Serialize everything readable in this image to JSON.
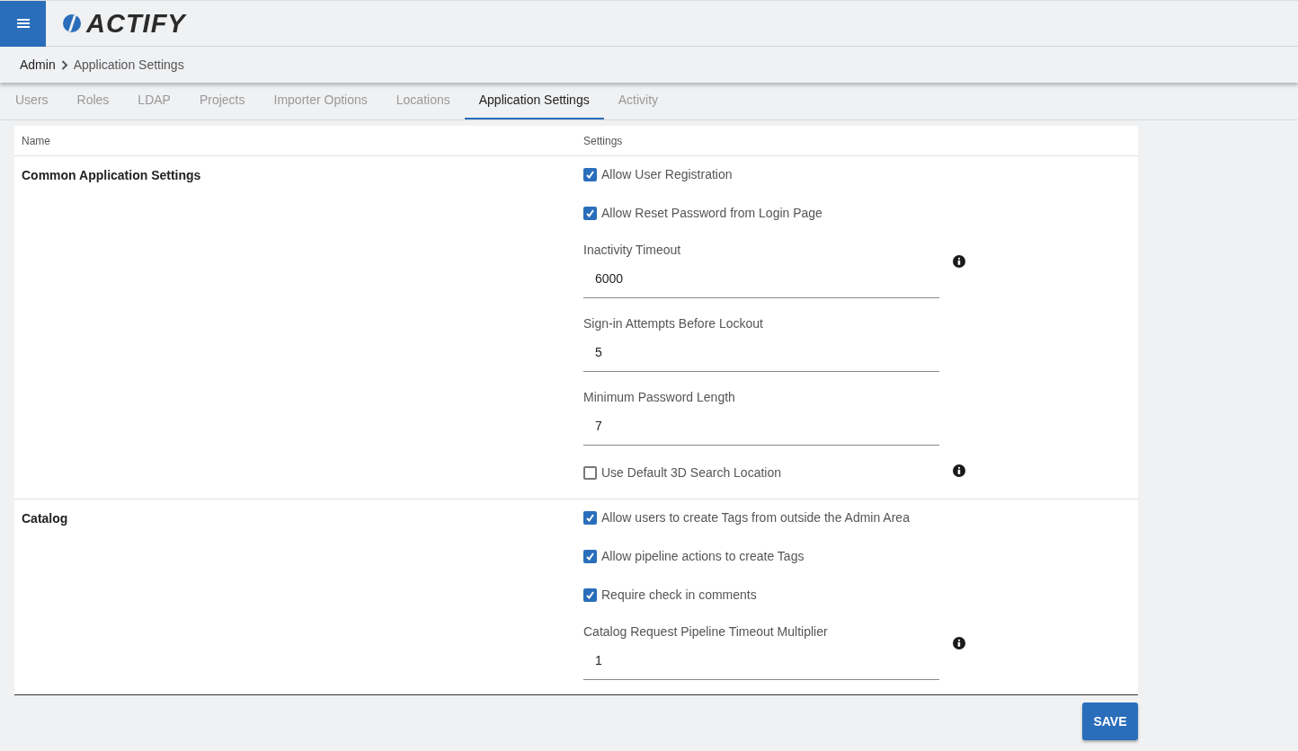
{
  "header": {
    "logo": "ACTIFY"
  },
  "breadcrumb": [
    "Admin",
    "Application Settings"
  ],
  "tabs": [
    {
      "label": "Users",
      "selected": false
    },
    {
      "label": "Roles",
      "selected": false
    },
    {
      "label": "LDAP",
      "selected": false
    },
    {
      "label": "Projects",
      "selected": false
    },
    {
      "label": "Importer Options",
      "selected": false
    },
    {
      "label": "Locations",
      "selected": false
    },
    {
      "label": "Application Settings",
      "selected": true
    },
    {
      "label": "Activity",
      "selected": false
    }
  ],
  "table": {
    "columns": [
      "Name",
      "Settings"
    ],
    "rows": [
      {
        "name": "Common Application Settings",
        "settings": [
          {
            "kind": "checkbox",
            "label": "Allow User Registration",
            "checked": true,
            "info": false
          },
          {
            "kind": "checkbox",
            "label": "Allow Reset Password from Login Page",
            "checked": true,
            "info": false
          },
          {
            "kind": "field",
            "label": "Inactivity Timeout",
            "value": "6000",
            "info": true
          },
          {
            "kind": "field",
            "label": "Sign-in Attempts Before Lockout",
            "value": "5",
            "info": false
          },
          {
            "kind": "field",
            "label": "Minimum Password Length",
            "value": "7",
            "info": false
          },
          {
            "kind": "checkbox",
            "label": "Use Default 3D Search Location",
            "checked": false,
            "info": true
          }
        ]
      },
      {
        "name": "Catalog",
        "settings": [
          {
            "kind": "checkbox",
            "label": "Allow users to create Tags from outside the Admin Area",
            "checked": true,
            "info": false
          },
          {
            "kind": "checkbox",
            "label": "Allow pipeline actions to create Tags",
            "checked": true,
            "info": false
          },
          {
            "kind": "checkbox",
            "label": "Require check in comments",
            "checked": true,
            "info": false
          },
          {
            "kind": "field",
            "label": "Catalog Request Pipeline Timeout Multiplier",
            "value": "1",
            "info": true
          }
        ]
      }
    ]
  },
  "save_button": "SAVE"
}
